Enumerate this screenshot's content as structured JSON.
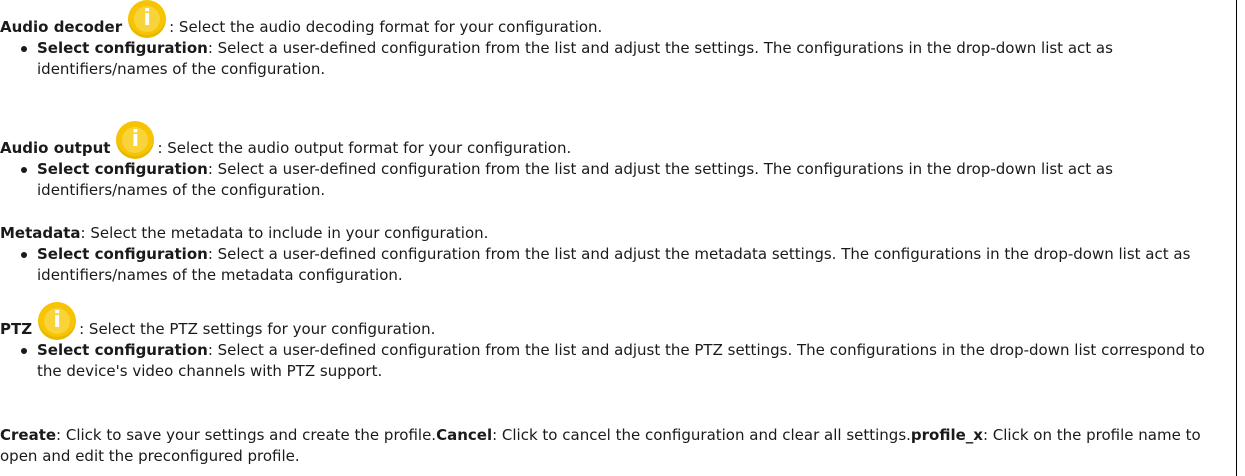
{
  "audio_decoder": {
    "title": "Audio decoder",
    "description": ": Select the audio decoding format for your configuration.",
    "bullet_label": "Select configuration",
    "bullet_text": ": Select a user-defined configuration from the list and adjust the settings. The configurations in the drop-down list act as identifiers/names of the configuration."
  },
  "audio_output": {
    "title": "Audio output",
    "description": ": Select the audio output format for your configuration.",
    "bullet_label": "Select configuration",
    "bullet_text": ": Select a user-defined configuration from the list and adjust the settings. The configurations in the drop-down list act as identifiers/names of the configuration."
  },
  "metadata": {
    "title": "Metadata",
    "description": ": Select the metadata to include in your configuration.",
    "bullet_label": "Select configuration",
    "bullet_text": ": Select a user-defined configuration from the list and adjust the metadata settings. The configurations in the drop-down list act as identifiers/names of the metadata configuration."
  },
  "ptz": {
    "title": "PTZ",
    "description": ": Select the PTZ settings for your configuration.",
    "bullet_label": "Select configuration",
    "bullet_text": ": Select a user-defined configuration from the list and adjust the PTZ settings. The configurations in the drop-down list correspond to the device's video channels with PTZ support."
  },
  "footer": {
    "create_label": "Create",
    "create_text": ": Click to save your settings and create the profile.",
    "cancel_label": "Cancel",
    "cancel_text": ": Click to cancel the configuration and clear all settings.",
    "profile_label": "profile_x",
    "profile_text": ": Click on the profile name to open and edit the preconfigured profile."
  },
  "icons": {
    "info_glyph": "i",
    "info_color": "#f6c400"
  }
}
